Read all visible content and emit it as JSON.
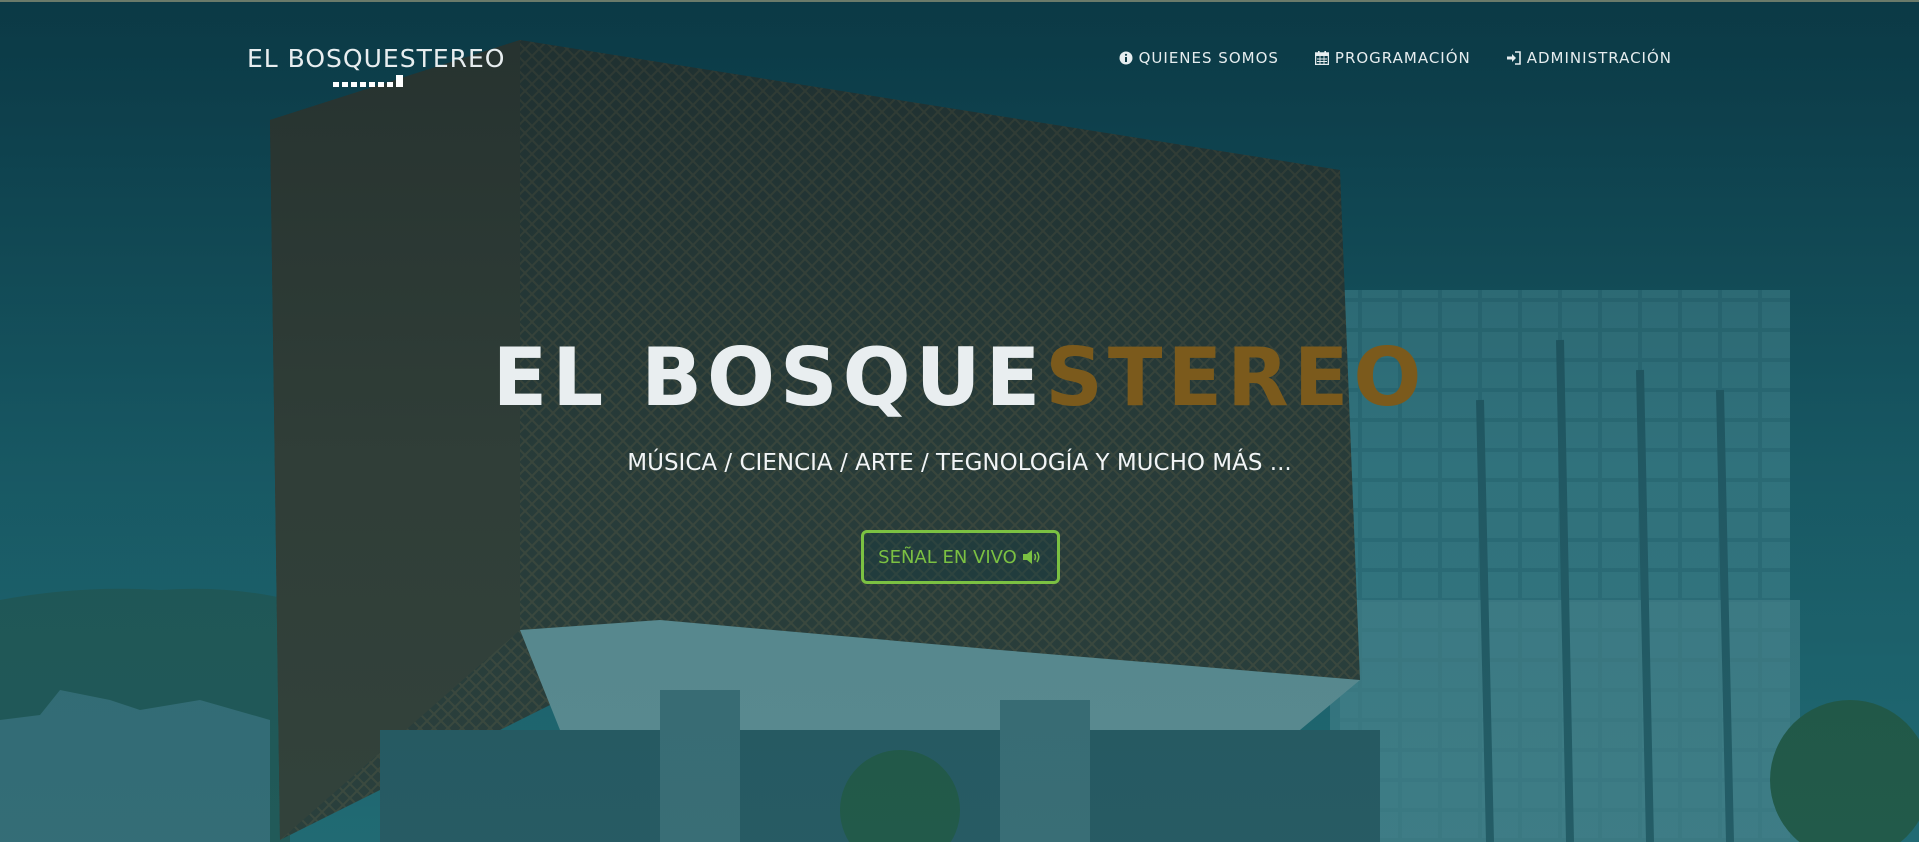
{
  "nav": {
    "brand": "EL BOSQUESTEREO",
    "items": [
      {
        "label": "QUIENES SOMOS",
        "icon": "info-circle-icon"
      },
      {
        "label": "PROGRAMACIÓN",
        "icon": "calendar-icon"
      },
      {
        "label": "ADMINISTRACIÓN",
        "icon": "sign-in-icon"
      }
    ]
  },
  "hero": {
    "title_part1": "EL BOSQUE",
    "title_part2": "STEREO",
    "subtitle": "MÚSICA / CIENCIA / ARTE / TEGNOLOGÍA Y MUCHO MÁS ...",
    "live_button": "SEÑAL EN VIVO",
    "live_icon": "volume-up-icon"
  },
  "colors": {
    "accent_gold": "#7b5a1c",
    "button_green": "#7bc142",
    "overlay_teal": "#0d3a46"
  }
}
